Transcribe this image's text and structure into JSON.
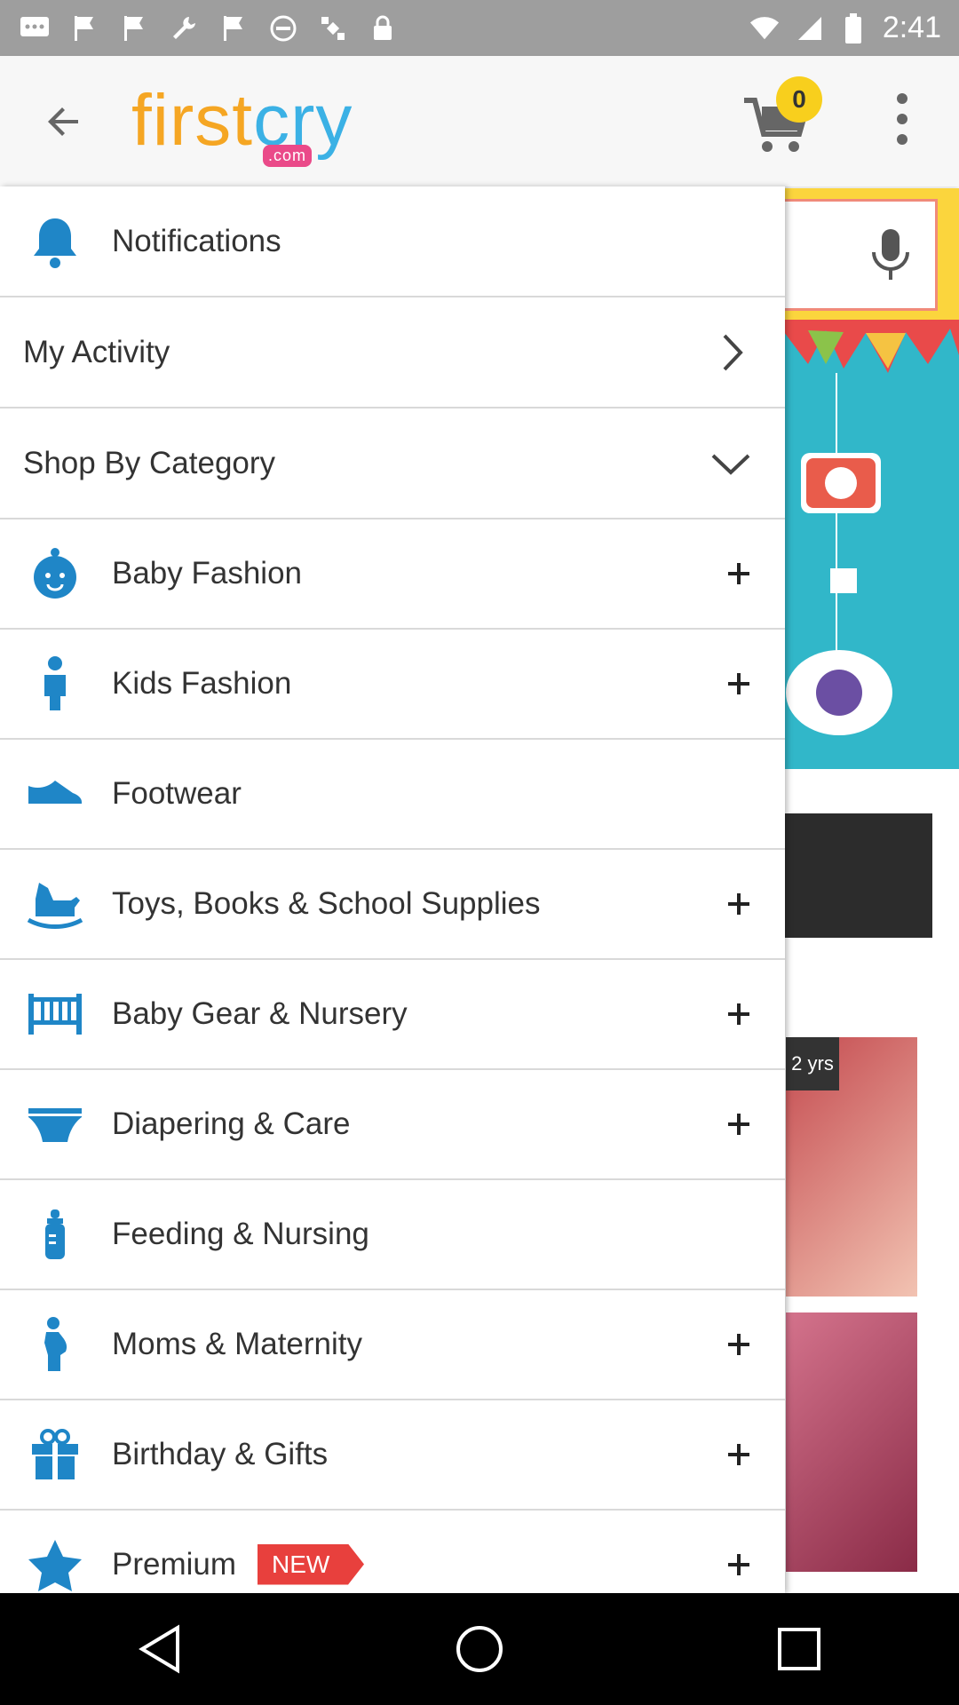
{
  "status_bar": {
    "time": "2:41"
  },
  "app_bar": {
    "logo_part1": "first",
    "logo_part2": "cry",
    "logo_domain": ".com",
    "cart_count": "0"
  },
  "background": {
    "age_tag": "2 yrs"
  },
  "drawer": {
    "notifications": "Notifications",
    "my_activity": "My Activity",
    "shop_by_category": "Shop By Category",
    "categories": [
      {
        "label": "Baby Fashion",
        "icon": "baby-face-icon",
        "expandable": true
      },
      {
        "label": "Kids Fashion",
        "icon": "kid-figure-icon",
        "expandable": true
      },
      {
        "label": "Footwear",
        "icon": "shoe-icon",
        "expandable": false
      },
      {
        "label": "Toys, Books & School Supplies",
        "icon": "rocking-horse-icon",
        "expandable": true
      },
      {
        "label": "Baby Gear & Nursery",
        "icon": "crib-icon",
        "expandable": true
      },
      {
        "label": "Diapering & Care",
        "icon": "diaper-icon",
        "expandable": true
      },
      {
        "label": "Feeding & Nursing",
        "icon": "bottle-icon",
        "expandable": false
      },
      {
        "label": "Moms & Maternity",
        "icon": "pregnant-woman-icon",
        "expandable": true
      },
      {
        "label": "Birthday & Gifts",
        "icon": "gift-icon",
        "expandable": true
      },
      {
        "label": "Premium",
        "icon": "star-icon",
        "expandable": true,
        "badge": "NEW"
      }
    ]
  },
  "colors": {
    "accent_blue": "#1f86c7",
    "badge_yellow": "#f8cf1d",
    "new_red": "#e8403d"
  }
}
